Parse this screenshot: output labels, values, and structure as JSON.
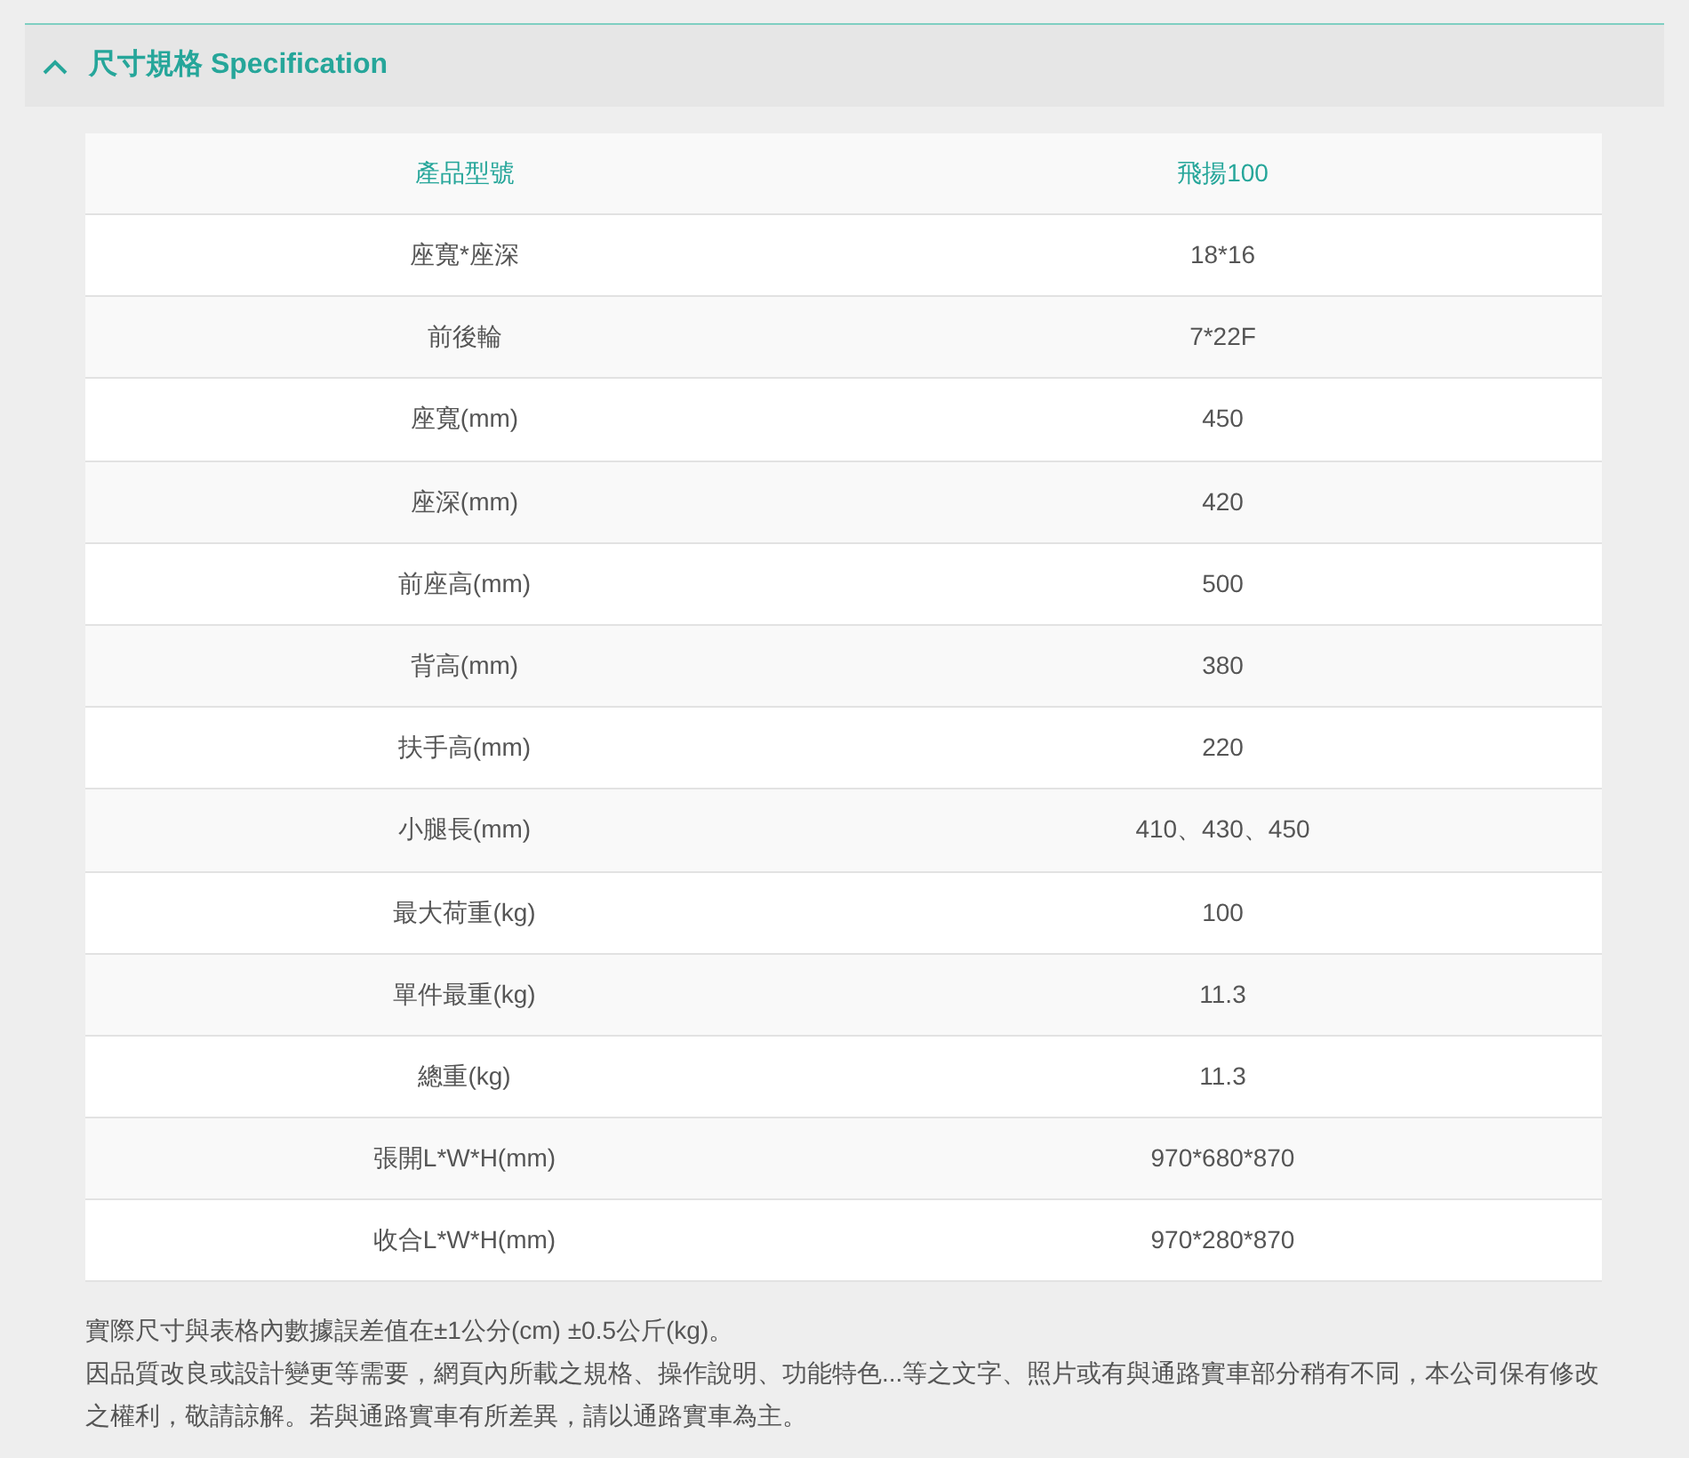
{
  "section": {
    "title": "尺寸規格 Specification",
    "expanded": true
  },
  "table": {
    "columns": [
      "產品型號",
      "飛揚100"
    ],
    "rows": [
      [
        "座寬*座深",
        "18*16"
      ],
      [
        "前後輪",
        "7*22F"
      ],
      [
        "座寬(mm)",
        "450"
      ],
      [
        "座深(mm)",
        "420"
      ],
      [
        "前座高(mm)",
        "500"
      ],
      [
        "背高(mm)",
        "380"
      ],
      [
        "扶手高(mm)",
        "220"
      ],
      [
        "小腿長(mm)",
        "410、430、450"
      ],
      [
        "最大荷重(kg)",
        "100"
      ],
      [
        "單件最重(kg)",
        "11.3"
      ],
      [
        "總重(kg)",
        "11.3"
      ],
      [
        "張開L*W*H(mm)",
        "970*680*870"
      ],
      [
        "收合L*W*H(mm)",
        "970*280*870"
      ]
    ]
  },
  "notes": [
    "實際尺寸與表格內數據誤差值在±1公分(cm) ±0.5公斤(kg)。",
    "因品質改良或設計變更等需要，網頁內所載之規格、操作說明、功能特色...等之文字、照片或有與通路實車部分稍有不同，本公司保有修改之權利，敬請諒解。若與通路實車有所差異，請以通路實車為主。"
  ]
}
